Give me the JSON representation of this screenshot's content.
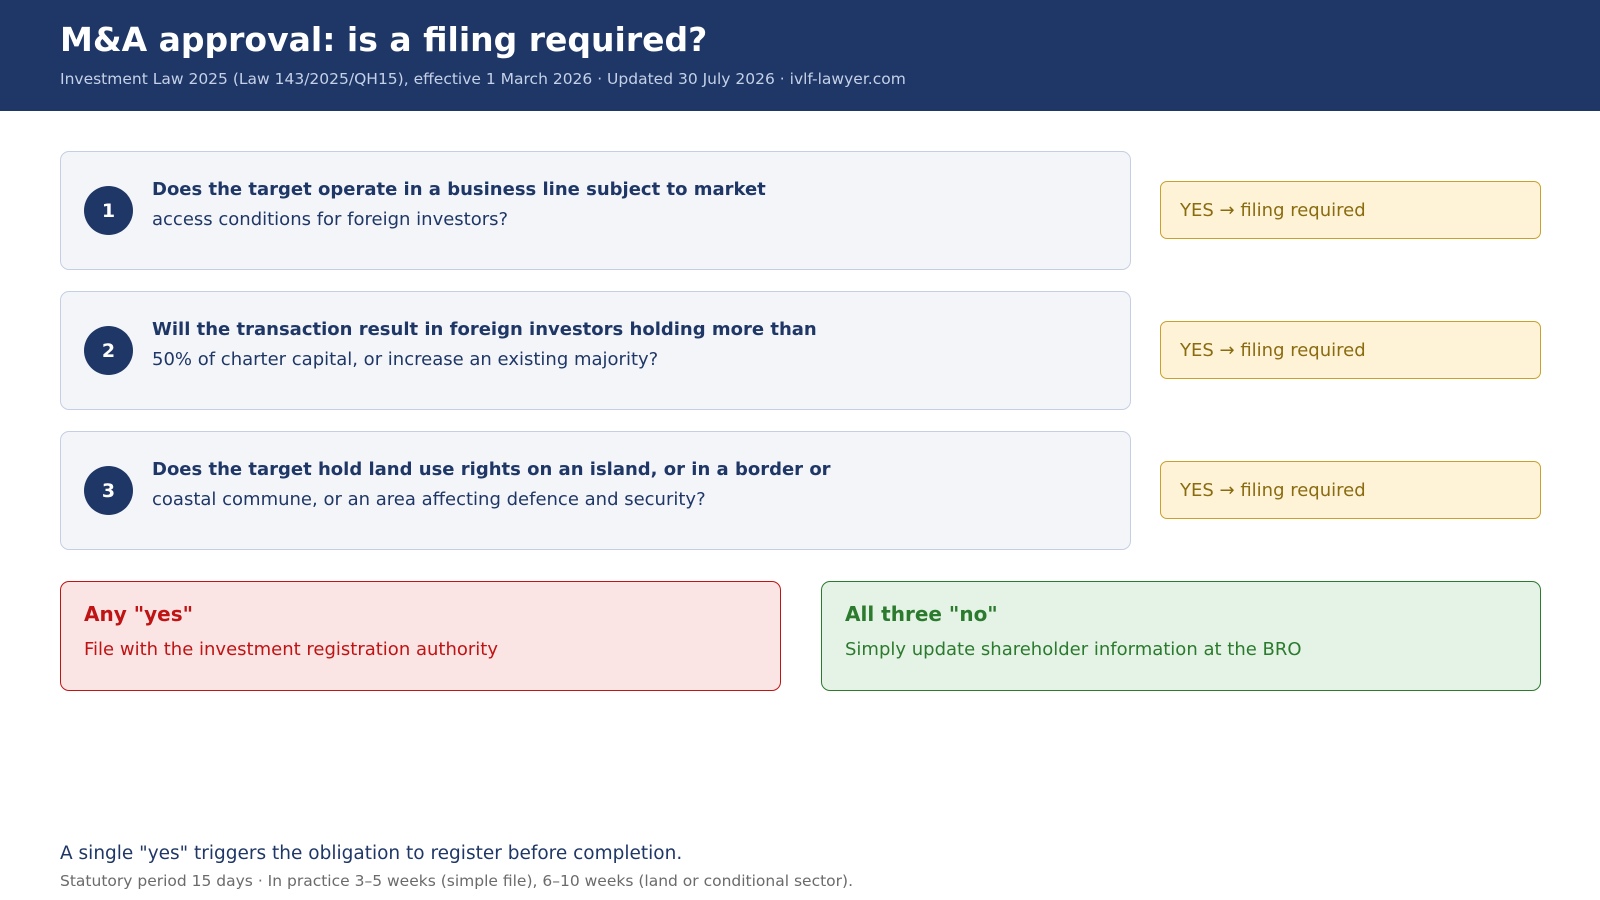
{
  "header": {
    "title": "M&A approval: is a filing required?",
    "subtitle": "Investment Law 2025 (Law 143/2025/QH15), effective 1 March 2026 · Updated 30 July 2026 · ivlf-lawyer.com"
  },
  "questions": [
    {
      "number": "1",
      "bold_text": "Does the target operate in a business line subject to market",
      "rest_text": "access conditions for foreign investors?",
      "outcome": "YES  →  filing required"
    },
    {
      "number": "2",
      "bold_text": "Will the transaction result in foreign investors holding more than",
      "rest_text": "50% of charter capital, or increase an existing majority?",
      "outcome": "YES  →  filing required"
    },
    {
      "number": "3",
      "bold_text": "Does the target hold land use rights on an island, or in a border or",
      "rest_text": "coastal commune, or an area affecting defence and security?",
      "outcome": "YES  →  filing required"
    }
  ],
  "results": {
    "any_yes": {
      "title": "Any \"yes\"",
      "text": "File with the investment registration authority"
    },
    "all_no": {
      "title": "All three \"no\"",
      "text": "Simply update shareholder information at the BRO"
    }
  },
  "footer": {
    "note": "A single \"yes\" triggers the obligation to register before completion.",
    "detail": "Statutory period 15 days · In practice 3–5 weeks (simple file), 6–10 weeks (land or conditional sector)."
  },
  "colors": {
    "navy": "#1f3766",
    "yes_fill": "#fef3d6",
    "yes_border": "#c9a02a",
    "red": "#c01313",
    "green": "#2b7a2e"
  }
}
